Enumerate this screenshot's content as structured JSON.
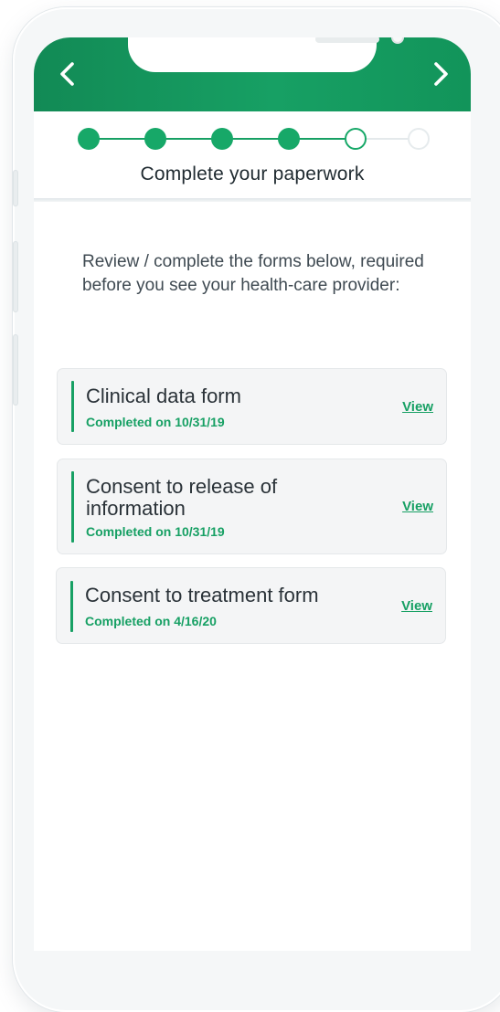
{
  "header": {
    "back_icon": "chevron-left-icon",
    "forward_icon": "chevron-right-icon",
    "color": "#17a064"
  },
  "progress": {
    "total_steps": 6,
    "completed_steps": 4,
    "current_step": 5
  },
  "page": {
    "title": "Complete your paperwork",
    "instructions": "Review / complete the forms below, required before you see your health-care provider:"
  },
  "forms": [
    {
      "title": "Clinical data form",
      "status": "Completed on 10/31/19",
      "action_label": "View"
    },
    {
      "title": "Consent to release of information",
      "status": "Completed on 10/31/19",
      "action_label": "View"
    },
    {
      "title": "Consent to treatment form",
      "status": "Completed on 4/16/20",
      "action_label": "View"
    }
  ],
  "colors": {
    "accent": "#17a064",
    "card_background": "#f4f5f6",
    "text_primary": "#2a3238"
  }
}
